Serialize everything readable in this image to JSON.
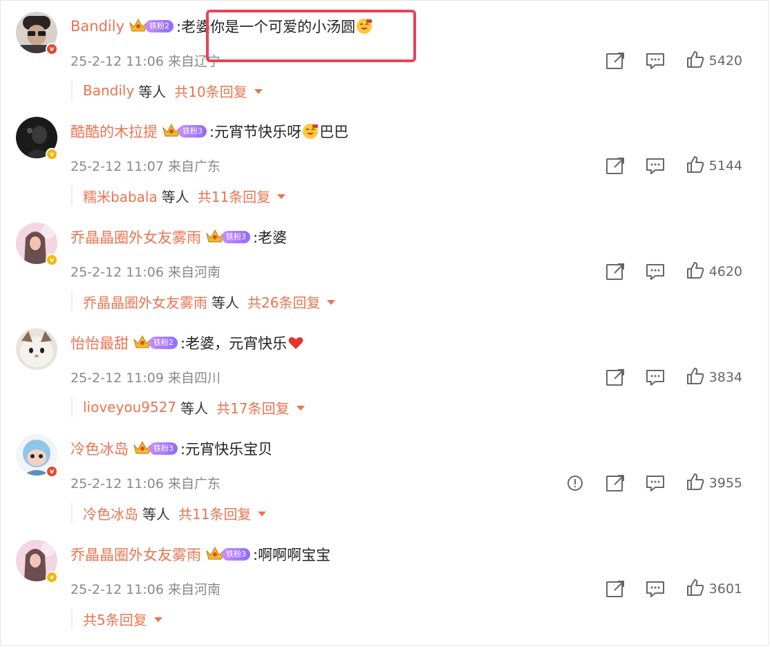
{
  "comments": [
    {
      "username": "Bandily",
      "fan_level": "铁粉2",
      "text": ":老婆你是一个可爱的小汤圆",
      "has_emoji": true,
      "meta": "25-2-12 11:06 来自辽宁",
      "likes": "5420",
      "reply_user": "Bandily",
      "reply_etc": "等人",
      "reply_count": "共10条回复",
      "verified": "red"
    },
    {
      "username": "酷酷的木拉提",
      "fan_level": "铁粉3",
      "text": ":元宵节快乐呀",
      "text_after": "巴巴",
      "has_emoji": true,
      "meta": "25-2-12 11:07 来自广东",
      "likes": "5144",
      "reply_user": "糯米babala",
      "reply_etc": "等人",
      "reply_count": "共11条回复",
      "verified": "gold"
    },
    {
      "username": "乔晶晶圈外女友雾雨",
      "fan_level": "铁粉3",
      "text": ":老婆",
      "meta": "25-2-12 11:06 来自河南",
      "likes": "4620",
      "reply_user": "乔晶晶圈外女友雾雨",
      "reply_etc": "等人",
      "reply_count": "共26条回复",
      "verified": "gold"
    },
    {
      "username": "怡怡最甜",
      "fan_level": "铁粉2",
      "text": ":老婆，元宵快乐",
      "has_heart": true,
      "meta": "25-2-12 11:09 来自四川",
      "likes": "3834",
      "reply_user": "lioveyou9527",
      "reply_etc": "等人",
      "reply_count": "共17条回复",
      "verified": "none"
    },
    {
      "username": "冷色冰岛",
      "fan_level": "铁粉3",
      "text": ":元宵快乐宝贝",
      "meta": "25-2-12 11:06 来自广东",
      "likes": "3955",
      "reply_user": "冷色冰岛",
      "reply_etc": "等人",
      "reply_count": "共11条回复",
      "verified": "red",
      "has_report": true
    },
    {
      "username": "乔晶晶圈外女友雾雨",
      "fan_level": "铁粉3",
      "text": ":啊啊啊宝宝",
      "meta": "25-2-12 11:06 来自河南",
      "likes": "3601",
      "reply_user": "",
      "reply_etc": "",
      "reply_count": "共5条回复",
      "verified": "gold"
    }
  ],
  "icons": {
    "share": "share-icon",
    "comment": "comment-icon",
    "like": "thumbs-up-icon",
    "report": "report-icon"
  },
  "colors": {
    "username": "#eb7350",
    "highlight_box": "#e8435a",
    "meta": "#888888"
  }
}
